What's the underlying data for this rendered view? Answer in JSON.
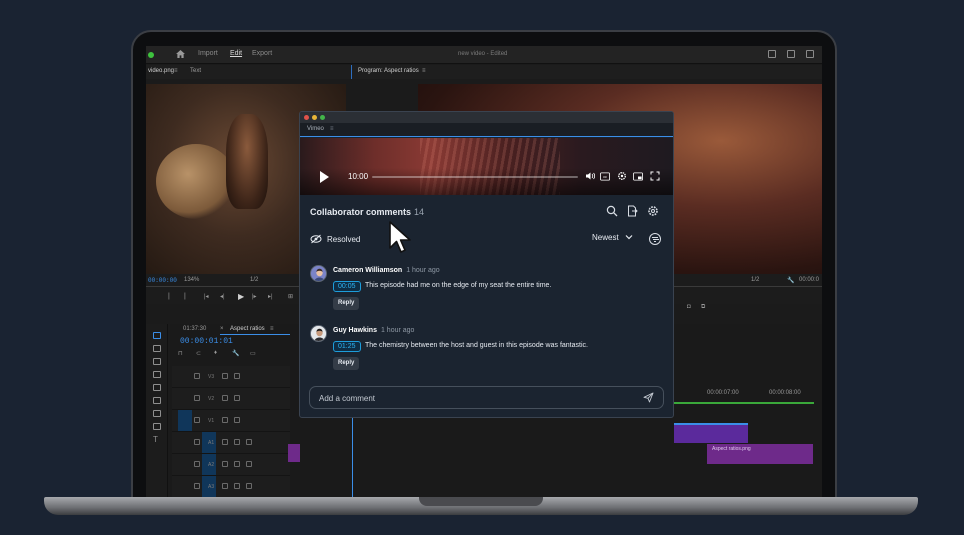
{
  "premiere": {
    "nav": [
      "Import",
      "Edit",
      "Export"
    ],
    "active_nav": "Edit",
    "project_title": "new video - Edited",
    "source_tab": "video.png",
    "source_tab_extra": "Text",
    "program_tab": "Program: Aspect ratios",
    "source_timecode": "00:00:00",
    "zoom": "134%",
    "source_fraction": "1/2",
    "program_fraction": "1/2",
    "program_timecode": "00:00:0",
    "sequence_tab": "Aspect ratios",
    "sequence_timecode_small": "01:37:30",
    "sequence_timecode": "00:00:01:01",
    "ruler_1": "00:00:07:00",
    "ruler_2": "00:00:08:00",
    "clip_label": "Aspect ratios.png",
    "tracks": [
      "V3",
      "V2",
      "V1",
      "A1",
      "A2",
      "A3"
    ]
  },
  "vimeo": {
    "tab_label": "Vimeo",
    "player": {
      "time": "10:00",
      "progress": 0.0,
      "icons": [
        "volume-icon",
        "cc-icon",
        "settings-icon",
        "pip-icon",
        "fullscreen-icon"
      ]
    },
    "comments_header": {
      "title": "Collaborator comments",
      "count": "14"
    },
    "filter": {
      "resolved_label": "Resolved",
      "sort_label": "Newest"
    },
    "comments": [
      {
        "author": "Cameron Williamson",
        "time": "1 hour ago",
        "timestamp": "00:05",
        "text": "This episode had me on the edge of my seat the entire time.",
        "reply_label": "Reply"
      },
      {
        "author": "Guy Hawkins",
        "time": "1 hour ago",
        "timestamp": "01:25",
        "text": "The chemistry between the host and guest in this episode was fantastic.",
        "reply_label": "Reply"
      }
    ],
    "composer": {
      "placeholder": "Add a comment"
    }
  },
  "colors": {
    "background": "#1a2332",
    "panel": "#1b2430",
    "timestamp_accent": "#2db5f5",
    "premiere_blue": "#3b8ee8"
  }
}
